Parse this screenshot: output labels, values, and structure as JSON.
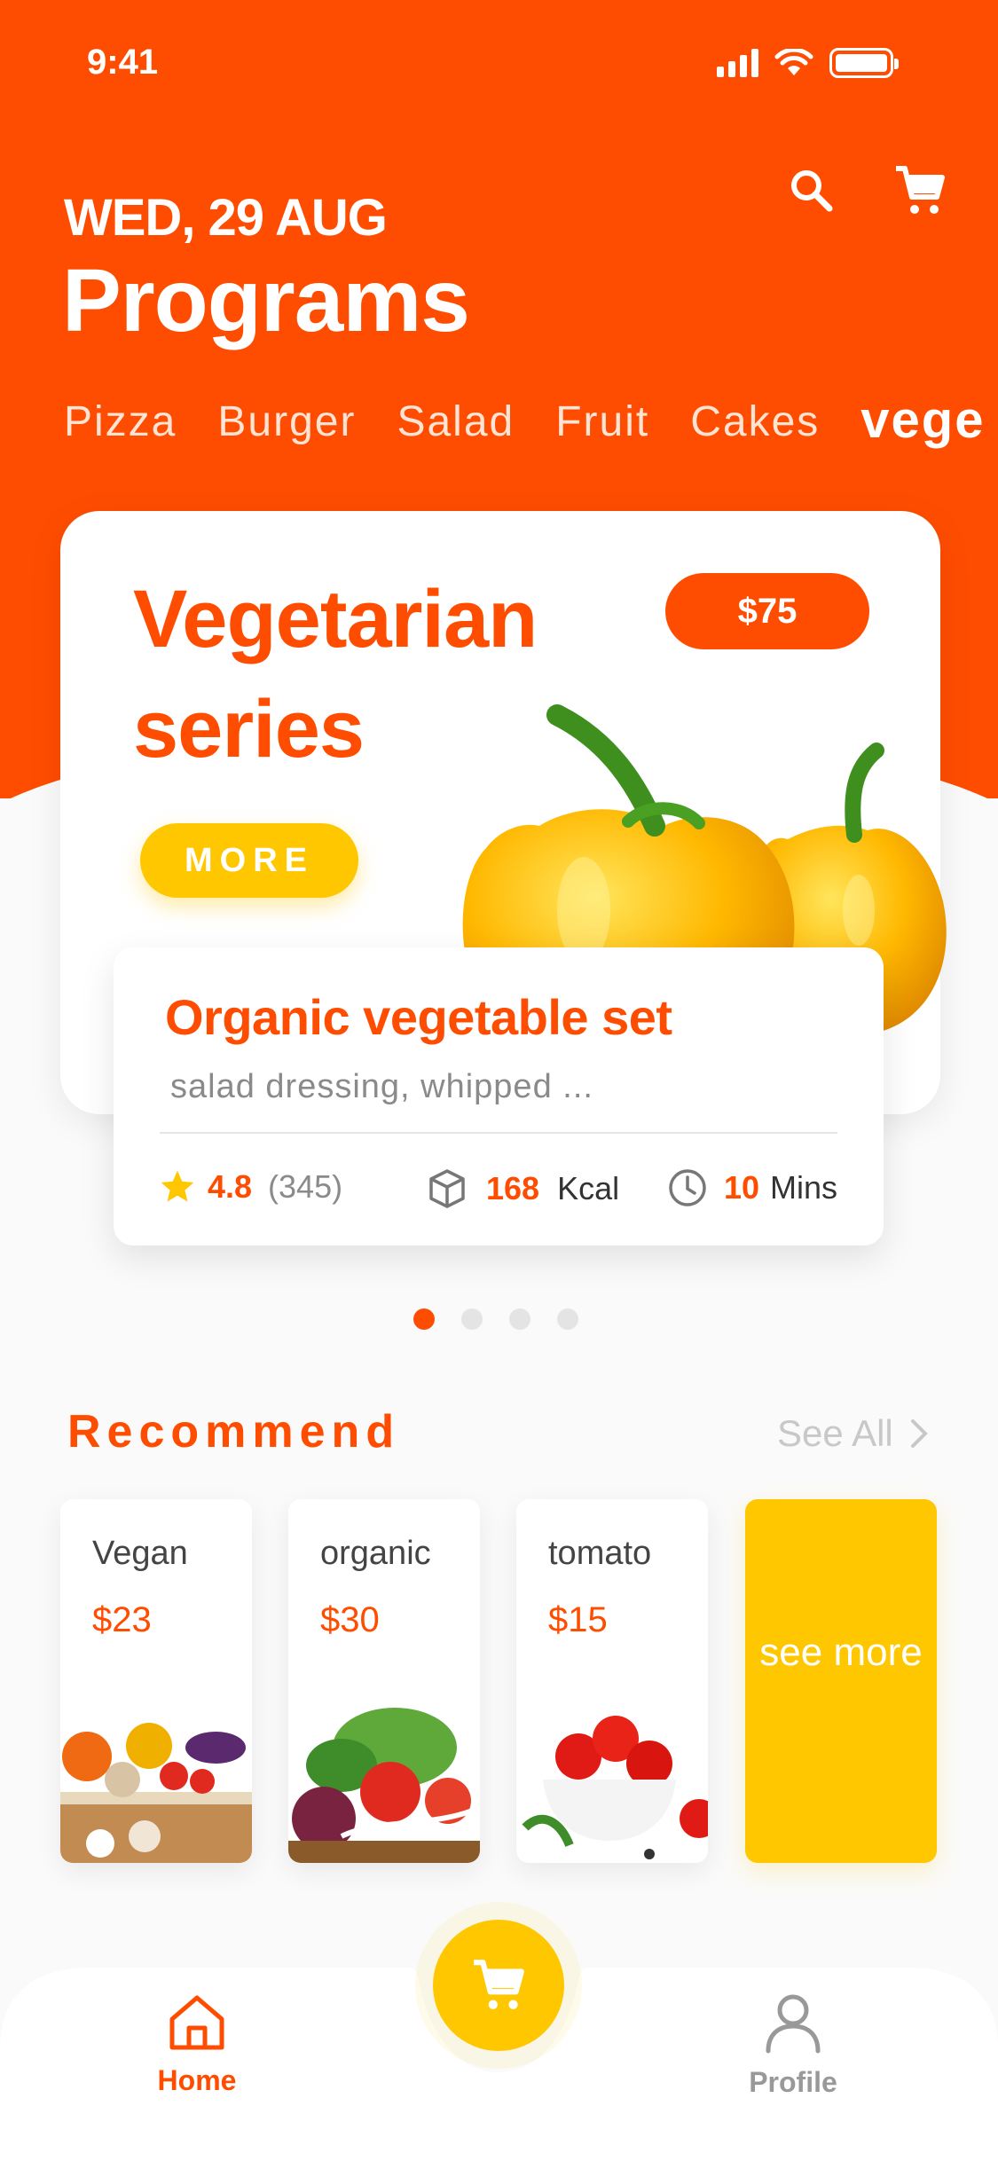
{
  "status_bar": {
    "time": "9:41"
  },
  "header": {
    "date": "WED, 29 AUG",
    "title": "Programs"
  },
  "category_tabs": [
    {
      "label": "Pizza"
    },
    {
      "label": "Burger"
    },
    {
      "label": "Salad"
    },
    {
      "label": "Fruit"
    },
    {
      "label": "Cakes"
    },
    {
      "label": "vege",
      "active": true
    }
  ],
  "featured": {
    "title": "Vegetarian series",
    "price": "$75",
    "more_label": "MORE",
    "product_title": "Organic vegetable set",
    "description": "salad dressing, whipped ...",
    "rating": "4.8",
    "reviews": "(345)",
    "kcal_value": "168",
    "kcal_unit": "Kcal",
    "time_value": "10",
    "time_unit": "Mins"
  },
  "pager": {
    "total": 4,
    "active": 1
  },
  "recommend": {
    "title": "Recommend",
    "see_all": "See All",
    "items": [
      {
        "name": "Vegan",
        "price": "$23"
      },
      {
        "name": "organic",
        "price": "$30"
      },
      {
        "name": "tomato",
        "price": "$15"
      }
    ],
    "see_more": "see more"
  },
  "bottom_nav": {
    "home": "Home",
    "profile": "Profile"
  },
  "colors": {
    "accent": "#fe4d00",
    "yellow": "#ffc700"
  }
}
